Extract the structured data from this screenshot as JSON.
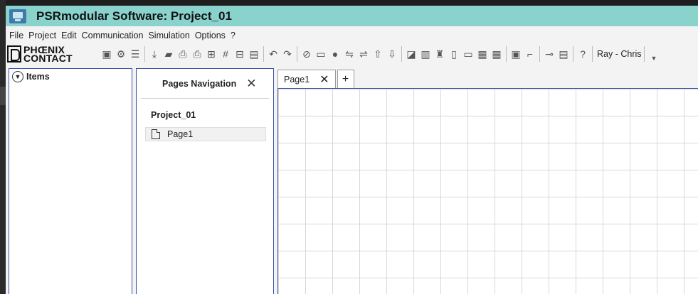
{
  "window": {
    "title": "PSRmodular Software: Project_01",
    "icon": "app-monitor-icon"
  },
  "menu": [
    "File",
    "Project",
    "Edit",
    "Communication",
    "Simulation",
    "Options",
    "?"
  ],
  "toolbar": {
    "logo_line1": "PHŒNIX",
    "logo_line2": "CONTACT",
    "groups": [
      [
        "new-project-icon",
        "project-settings-icon",
        "list-icon"
      ],
      [
        "download-icon",
        "open-folder-icon",
        "print-icon",
        "print-preview-icon",
        "grid-icon",
        "hash-grid-icon",
        "form-icon",
        "document-icon"
      ],
      [
        "undo-icon",
        "redo-icon"
      ],
      [
        "check-circle-icon",
        "device-icon",
        "location-icon",
        "connect-icon",
        "disconnect-icon",
        "upload-icon",
        "save-download-icon"
      ],
      [
        "chart-icon",
        "report-icon",
        "network-icon",
        "info-doc-icon",
        "card-icon",
        "table-icon",
        "table-delete-icon"
      ],
      [
        "module-icon",
        "link-module-icon"
      ],
      [
        "key-icon",
        "sign-icon"
      ],
      [
        "help-icon"
      ]
    ],
    "user": "Ray - Chris",
    "user_drop": "▼"
  },
  "items_panel": {
    "title": "Items",
    "chevron": "▼"
  },
  "pages_navigation": {
    "title": "Pages Navigation",
    "close": "✕",
    "project": "Project_01",
    "pages": [
      "Page1"
    ]
  },
  "tabs": [
    {
      "label": "Page1",
      "close": "✕"
    }
  ],
  "add_tab": "+",
  "colors": {
    "titlebar": "#8ad3cd",
    "panel_border": "#3d4fa8",
    "grid_line": "#d8d8d8"
  }
}
